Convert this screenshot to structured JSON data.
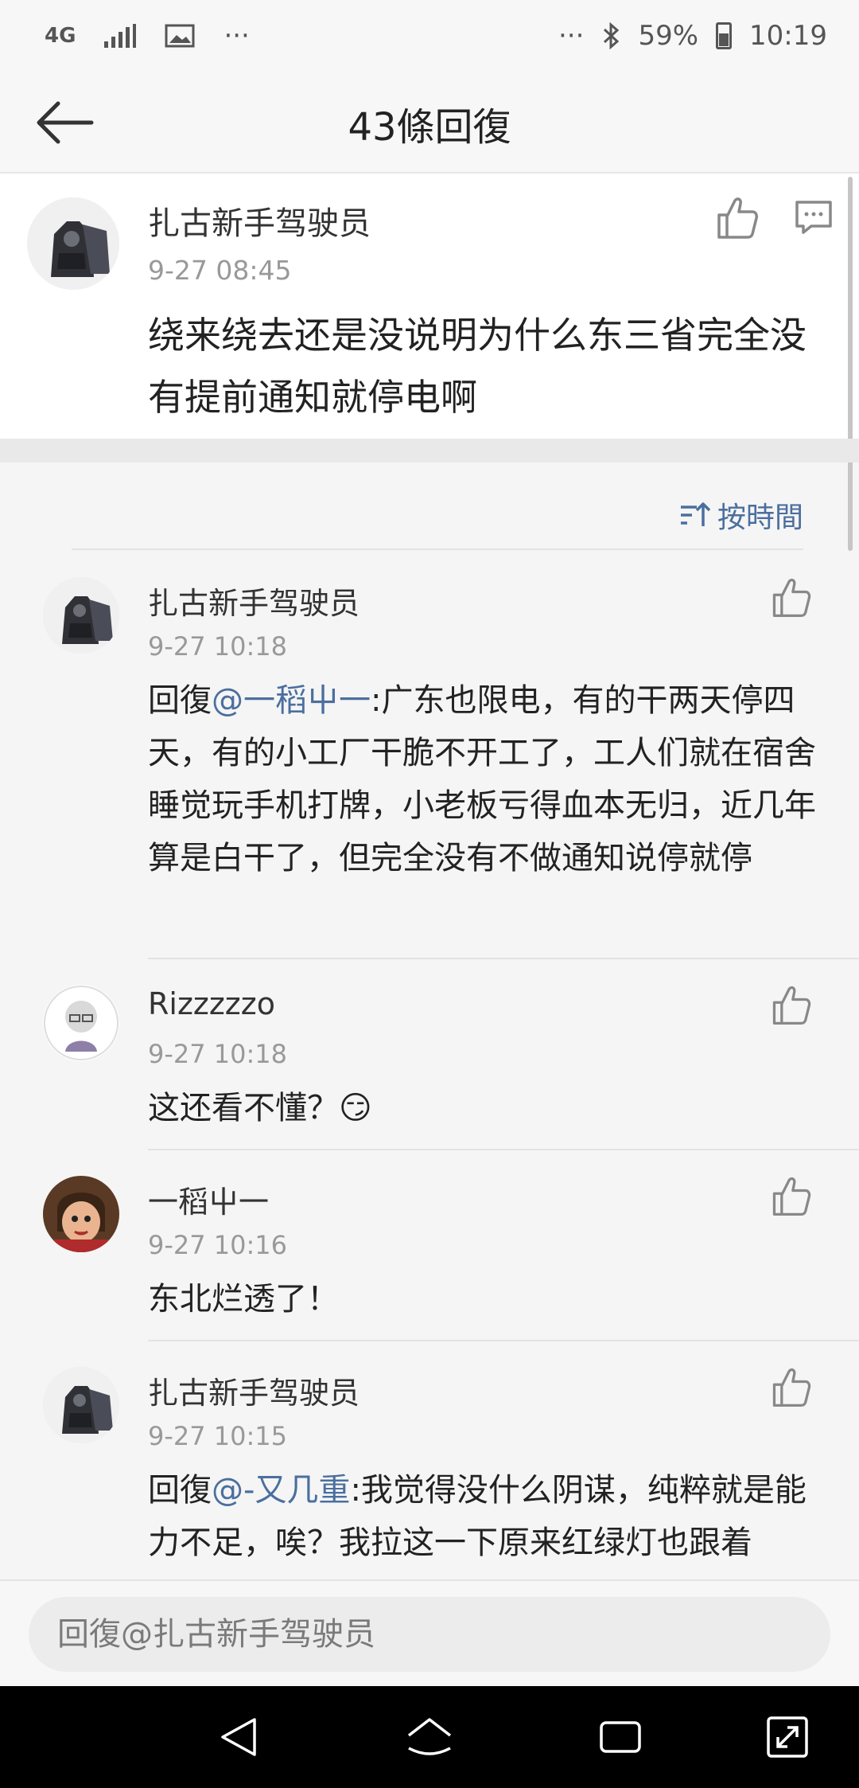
{
  "status_bar": {
    "network": "4G",
    "more": "···",
    "more_right": "···",
    "battery": "59%",
    "time": "10:19"
  },
  "header": {
    "title": "43條回復"
  },
  "post": {
    "username": "扎古新手驾驶员",
    "time": "9-27 08:45",
    "content": "绕来绕去还是没说明为什么东三省完全没有提前通知就停电啊"
  },
  "sort": {
    "label": "按時間"
  },
  "comments": [
    {
      "username": "扎古新手驾驶员",
      "time": "9-27 10:18",
      "reply_prefix": "回復",
      "mention": "@一稻屮一",
      "text": ":广东也限电，有的干两天停四天，有的小工厂干脆不开工了，工人们就在宿舍睡觉玩手机打牌，小老板亏得血本无归，近几年算是白干了，但完全没有不做通知说停就停"
    },
    {
      "username": "Rizzzzzo",
      "time": "9-27 10:18",
      "text": "这还看不懂？",
      "emoji": "😏"
    },
    {
      "username": "一稻屮一",
      "time": "9-27 10:16",
      "text": "东北烂透了！"
    },
    {
      "username": "扎古新手驾驶员",
      "time": "9-27 10:15",
      "reply_prefix": "回復",
      "mention": "@-又几重",
      "text": ":我觉得没什么阴谋，纯粹就是能力不足，唉？我拉这一下原来红绿灯也跟着"
    }
  ],
  "input": {
    "placeholder": "回復@扎古新手驾驶员"
  },
  "icons": {
    "back": "arrow-left-icon",
    "like": "thumbs-up-icon",
    "reply": "comment-icon",
    "sort": "sort-icon"
  },
  "colors": {
    "accent": "#4b6f9e",
    "secondary_text": "#999999",
    "background": "#f5f5f5"
  }
}
